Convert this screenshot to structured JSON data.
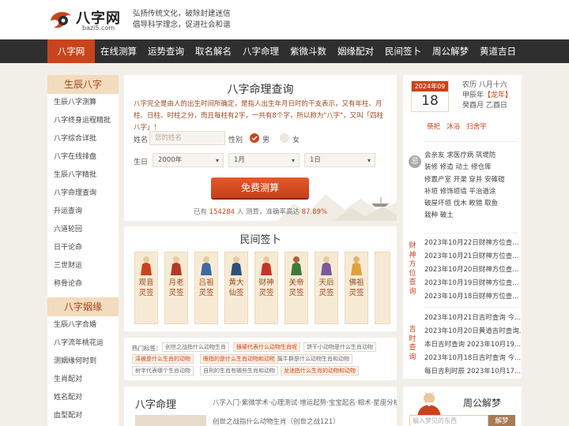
{
  "header": {
    "logo_text": "八字网",
    "logo_domain": "bazi5.com",
    "slogan_line1": "弘扬传统文化，破除封建迷信",
    "slogan_line2": "倡导科学理念，促进社会和谐"
  },
  "nav": [
    "八字网",
    "在线测算",
    "运势查询",
    "取名解名",
    "八字命理",
    "紫微斗数",
    "姻缘配对",
    "民间签卜",
    "周公解梦",
    "黄道吉日"
  ],
  "sidebar": {
    "heading1": "生辰八字",
    "items1": [
      "生辰八字测算",
      "八字终身运程精批",
      "八字综合详批",
      "八字在线排盘",
      "生辰八字精批",
      "八字命理查询",
      "升运查询",
      "六道轮回",
      "日干论命",
      "三世财运",
      "称骨论命"
    ],
    "heading2": "八字姻缘",
    "items2": [
      "生辰八字合婚",
      "八字流年桃花运",
      "测姻缘何时到",
      "生肖配对",
      "姓名配对",
      "血型配对"
    ]
  },
  "form": {
    "title": "八字命理查询",
    "intro": "八字完全是由人的出生时间所确定，是指人出生年月日时的干支表示，又有年柱、月柱、日柱、时柱之分，而且每柱有2字，一共有8个字，所以称为\"八字\"，又叫「四柱八字」！",
    "name_label": "姓名",
    "name_placeholder": "您的姓名",
    "gender_label": "性别",
    "male": "男",
    "female": "女",
    "birth_label": "生日",
    "year": "2000年",
    "month": "1月",
    "day": "1日",
    "submit": "免费测算",
    "stats_pre": "已有",
    "stats_count": "154284",
    "stats_mid": "人 测算，准确率高达",
    "stats_rate": "87.89%"
  },
  "qian": {
    "title": "民间签卜",
    "cards": [
      "观音灵签",
      "月老灵签",
      "吕祖灵签",
      "黄大仙签",
      "财神灵签",
      "关帝灵签",
      "天后灵签",
      "佛祖灵签"
    ]
  },
  "hot": {
    "label": "热门标签：",
    "tags": [
      "创世之战指什么动物生肖",
      "猴硬代表什么动物生肖呢",
      "饼干小动物是什么生肖动物",
      "泽被是什么生肖的动物",
      "眼指的是什么生肖动物和动物",
      "属牛群是什么动物生肖和动物",
      "树字代表哪个生肖动物",
      "自刑的生肖有哪些生肖和动物",
      "龙池指什么生肖的动物和动物"
    ]
  },
  "bazi": {
    "title": "八字命理",
    "links": "八字入门·紫微学术·心理测试·增运起势·宝宝起名·相术·星座分析",
    "first_item": "创世之战指什么动物生肖（创世之战121）"
  },
  "calendar": {
    "month": "2024年09月",
    "day": "18",
    "lunar": "农历 八月十六",
    "ganzhi_year_pre": "甲辰年",
    "ganzhi_year_tag": "【龙年】",
    "ganzhi_day": "癸酉月 乙酉日",
    "yi": [
      "祭祀",
      "沐浴",
      "扫舍宇"
    ],
    "ji_icon": "忌",
    "ji_lines": [
      "会亲友 求医疗病 筑堤防",
      "装修 修造 动土 修仓库",
      "修置产室 开渠 穿井 安碓磑",
      "补垣 修饰垣墙 平治道涂",
      "破屋坏垣 伐木 畋猎 取鱼",
      "栽种 破土"
    ],
    "caishen_label": "财神方位查询",
    "caishen_links": [
      "2023年10月22日财神方位查...",
      "2023年10月21日财神方位查...",
      "2023年10月20日财神方位查...",
      "2023年10月19日财神方位查...",
      "2023年10月18日财神方位查..."
    ],
    "jishi_label": "吉时查询",
    "jishi_links": [
      "2023年10月21日吉时查询 今...",
      "2023年10月20日黄道吉时查询...",
      "本日吉时查询 2023年10月19...",
      "2023年10月18日吉时查询 今...",
      "每日吉利时辰 2023年10月17..."
    ]
  },
  "dream": {
    "title": "周公解梦",
    "placeholder": "输入梦见的东西",
    "button": "解梦"
  },
  "colors": {
    "accent": "#c9441c",
    "nav_bg": "#2f2f2f",
    "sidebar_head": "#f3dbbd"
  }
}
